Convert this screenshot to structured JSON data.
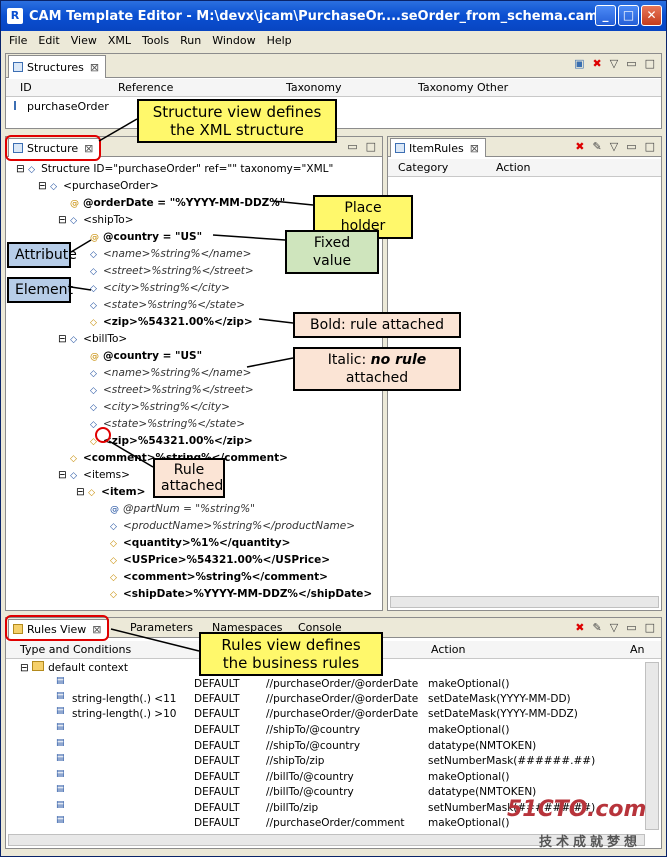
{
  "window": {
    "title": "CAM Template Editor - M:\\devx\\jcam\\PurchaseOr....seOrder_from_schema.cam"
  },
  "menu": [
    "File",
    "Edit",
    "View",
    "XML",
    "Tools",
    "Run",
    "Window",
    "Help"
  ],
  "structures_panel": {
    "tab": "Structures",
    "columns": [
      "ID",
      "Reference",
      "Taxonomy",
      "Taxonomy Other"
    ],
    "row": "purchaseOrder"
  },
  "structure_panel": {
    "tab": "Structure",
    "tree": [
      "Structure ID=\"purchaseOrder\" ref=\"\" taxonomy=\"XML\"",
      "<purchaseOrder>",
      "@orderDate = \"%YYYY-MM-DDZ%\"",
      "<shipTo>",
      "@country = \"US\"",
      "<name>%string%</name>",
      "<street>%string%</street>",
      "<city>%string%</city>",
      "<state>%string%</state>",
      "<zip>%54321.00%</zip>",
      "<billTo>",
      "@country = \"US\"",
      "<name>%string%</name>",
      "<street>%string%</street>",
      "<city>%string%</city>",
      "<state>%string%</state>",
      "<zip>%54321.00%</zip>",
      "<comment>%string%</comment>",
      "<items>",
      "<item>",
      "@partNum = \"%string%\"",
      "<productName>%string%</productName>",
      "<quantity>%1%</quantity>",
      "<USPrice>%54321.00%</USPrice>",
      "<comment>%string%</comment>",
      "<shipDate>%YYYY-MM-DDZ%</shipDate>"
    ]
  },
  "itemrules_panel": {
    "tab": "ItemRules",
    "columns": [
      "Category",
      "Action"
    ]
  },
  "rules_panel": {
    "tabs": [
      "Rules View",
      "Parameters",
      "Namespaces",
      "Console"
    ],
    "columns": [
      "Type and Conditions",
      "Action",
      "An"
    ],
    "group": "default context",
    "rows": [
      {
        "cond": "",
        "cat": "DEFAULT",
        "path": "//purchaseOrder/@orderDate",
        "action": "makeOptional()"
      },
      {
        "cond": "string-length(.) <11",
        "cat": "DEFAULT",
        "path": "//purchaseOrder/@orderDate",
        "action": "setDateMask(YYYY-MM-DD)"
      },
      {
        "cond": "string-length(.) >10",
        "cat": "DEFAULT",
        "path": "//purchaseOrder/@orderDate",
        "action": "setDateMask(YYYY-MM-DDZ)"
      },
      {
        "cond": "",
        "cat": "DEFAULT",
        "path": "//shipTo/@country",
        "action": "makeOptional()"
      },
      {
        "cond": "",
        "cat": "DEFAULT",
        "path": "//shipTo/@country",
        "action": "datatype(NMTOKEN)"
      },
      {
        "cond": "",
        "cat": "DEFAULT",
        "path": "//shipTo/zip",
        "action": "setNumberMask(######.##)"
      },
      {
        "cond": "",
        "cat": "DEFAULT",
        "path": "//billTo/@country",
        "action": "makeOptional()"
      },
      {
        "cond": "",
        "cat": "DEFAULT",
        "path": "//billTo/@country",
        "action": "datatype(NMTOKEN)"
      },
      {
        "cond": "",
        "cat": "DEFAULT",
        "path": "//billTo/zip",
        "action": "setNumberMask(######.##)"
      },
      {
        "cond": "",
        "cat": "DEFAULT",
        "path": "//purchaseOrder/comment",
        "action": "makeOptional()"
      }
    ]
  },
  "callouts": {
    "structure_view": "Structure view defines the XML structure",
    "place_holder": "Place holder",
    "fixed_value": "Fixed value",
    "attribute": "Attribute",
    "element": "Element",
    "bold_rule": "Bold: rule attached",
    "italic_prefix": "Italic: ",
    "italic_bold": "no rule",
    "italic_suffix": " attached",
    "rule_attached": "Rule attached",
    "rules_view": "Rules view defines the business rules"
  },
  "watermark": {
    "line1": "51CTO.com",
    "line2": "技术成就梦想"
  }
}
